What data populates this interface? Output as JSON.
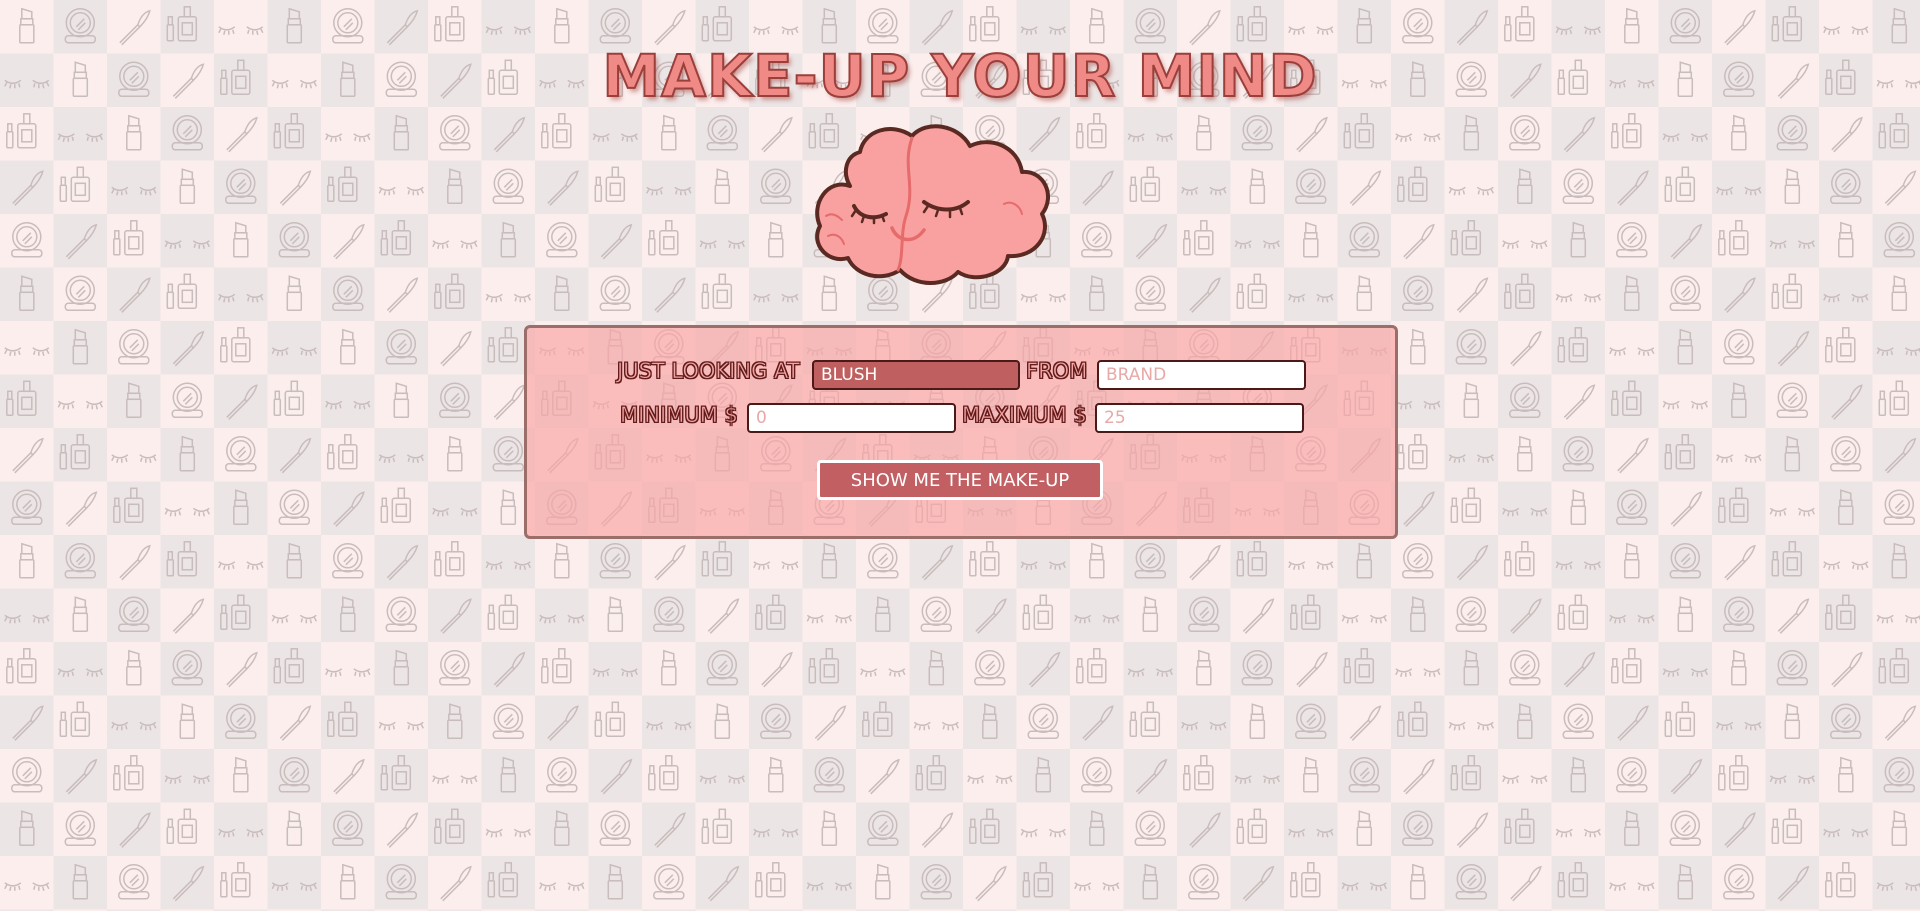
{
  "title": "MAKE-UP YOUR MIND",
  "form": {
    "looking_label": "JUST LOOKING AT",
    "product_value": "BLUSH",
    "from_label": "FROM",
    "brand_placeholder": "BRAND",
    "min_label": "MINIMUM $",
    "min_placeholder": "0",
    "max_label": "MAXIMUM $",
    "max_placeholder": "25",
    "submit_label": "SHOW ME THE MAKE-UP"
  },
  "icons": [
    "lipstick-icon",
    "nail-polish-icon",
    "compact-mirror-icon",
    "eyelashes-icon",
    "makeup-brush-icon",
    "brain-mascot-icon"
  ],
  "colors": {
    "accent": "#c25f62",
    "title_fill": "#f08a86",
    "panel": "#f9a5a5",
    "brain": "#f9a0a0",
    "background_light": "#fbeeed",
    "background_dark": "#ece5e5"
  }
}
